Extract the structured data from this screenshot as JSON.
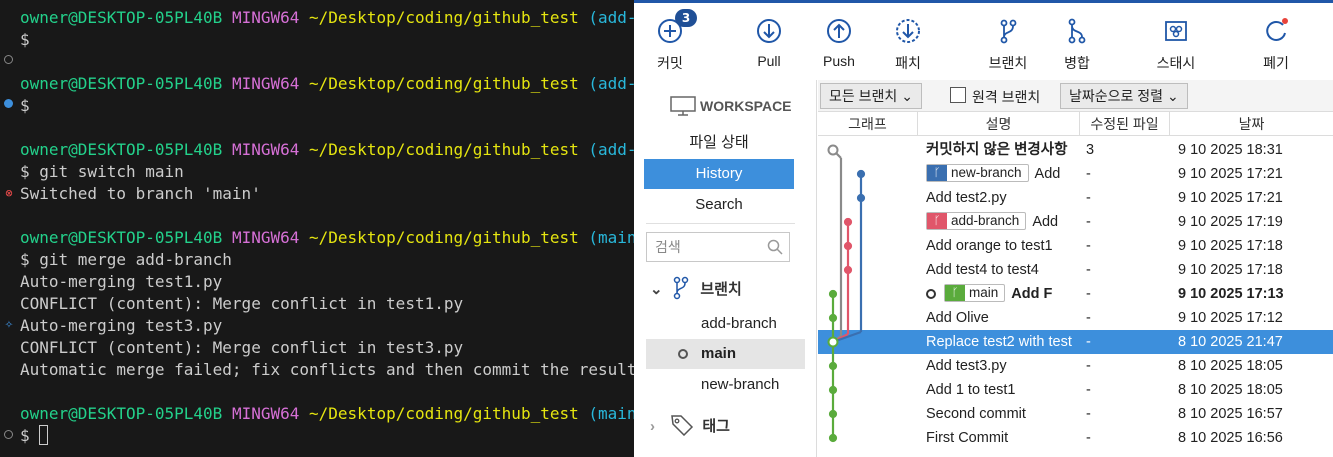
{
  "terminal": {
    "lines": [
      {
        "user": "owner@DESKTOP-05PL40B",
        "sys": "MINGW64",
        "path": "~/Desktop/coding/github_test",
        "branch": "(add-branch)"
      },
      {
        "text": "$"
      },
      {
        "user": "owner@DESKTOP-05PL40B",
        "sys": "MINGW64",
        "path": "~/Desktop/coding/github_test",
        "branch": "(add-branch)"
      },
      {
        "text": "$"
      },
      {
        "user": "owner@DESKTOP-05PL40B",
        "sys": "MINGW64",
        "path": "~/Desktop/coding/github_test",
        "branch": "(add-branch)"
      },
      {
        "text": "$ git switch main"
      },
      {
        "text": "Switched to branch 'main'"
      },
      {
        "user": "owner@DESKTOP-05PL40B",
        "sys": "MINGW64",
        "path": "~/Desktop/coding/github_test",
        "branch": "(main)"
      },
      {
        "text": "$ git merge add-branch"
      },
      {
        "text": "Auto-merging test1.py"
      },
      {
        "text": "CONFLICT (content): Merge conflict in test1.py"
      },
      {
        "text": "Auto-merging test3.py"
      },
      {
        "text": "CONFLICT (content): Merge conflict in test3.py"
      },
      {
        "text": "Automatic merge failed; fix conflicts and then commit the result."
      },
      {
        "user": "owner@DESKTOP-05PL40B",
        "sys": "MINGW64",
        "path": "~/Desktop/coding/github_test",
        "branch": "(main|MERGING)"
      },
      {
        "text": "$ "
      }
    ]
  },
  "toolbar": {
    "commit": "커밋",
    "commit_badge": "3",
    "pull": "Pull",
    "push": "Push",
    "fetch": "패치",
    "branch": "브랜치",
    "merge": "병합",
    "stash": "스태시",
    "discard": "폐기"
  },
  "sidebar": {
    "workspace": "WORKSPACE",
    "items": [
      "파일 상태",
      "History",
      "Search"
    ],
    "search_placeholder": "검색",
    "branches_title": "브랜치",
    "branches": [
      "add-branch",
      "main",
      "new-branch"
    ],
    "tags_title": "태그"
  },
  "filters": {
    "all_branches": "모든 브랜치",
    "remote_branches": "원격 브랜치",
    "sort": "날짜순으로 정렬"
  },
  "columns": [
    "그래프",
    "설명",
    "수정된 파일",
    "날짜"
  ],
  "commits": [
    {
      "desc": "커밋하지 않은 변경사항",
      "changes": "3",
      "date": "9 10 2025 18:31",
      "bold": true
    },
    {
      "tag": "new-branch",
      "tag_color": "#3a6fb0",
      "desc": "Add",
      "changes": "-",
      "date": "9 10 2025 17:21"
    },
    {
      "desc": "Add test2.py",
      "changes": "-",
      "date": "9 10 2025 17:21"
    },
    {
      "tag": "add-branch",
      "tag_color": "#e0566a",
      "desc": "Add",
      "changes": "-",
      "date": "9 10 2025 17:19"
    },
    {
      "desc": "Add orange to test1",
      "changes": "-",
      "date": "9 10 2025 17:18"
    },
    {
      "desc": "Add test4 to test4",
      "changes": "-",
      "date": "9 10 2025 17:18"
    },
    {
      "tag": "main",
      "tag_color": "#5aab3c",
      "head": true,
      "desc": "Add F",
      "changes": "-",
      "date": "9 10 2025 17:13",
      "bold": true
    },
    {
      "desc": "Add Olive",
      "changes": "-",
      "date": "9 10 2025 17:12"
    },
    {
      "desc": "Replace test2 with test",
      "changes": "-",
      "date": "8 10 2025 21:47",
      "selected": true
    },
    {
      "desc": "Add test3.py",
      "changes": "-",
      "date": "8 10 2025 18:05"
    },
    {
      "desc": "Add 1 to test1",
      "changes": "-",
      "date": "8 10 2025 18:05"
    },
    {
      "desc": "Second commit",
      "changes": "-",
      "date": "8 10 2025 16:57"
    },
    {
      "desc": "First Commit",
      "changes": "-",
      "date": "8 10 2025 16:56"
    }
  ],
  "colors": {
    "main": "#5aab3c",
    "add_branch": "#e0566a",
    "new_branch": "#3a6fb0",
    "accent": "#3d8fdc",
    "uncommitted": "#8a8a8a"
  }
}
